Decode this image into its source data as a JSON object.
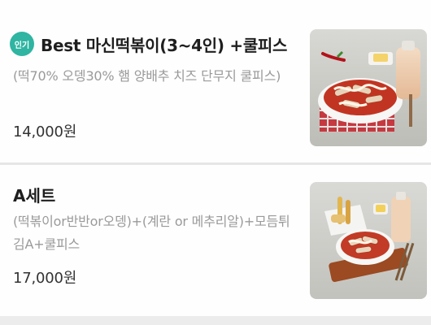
{
  "menu": {
    "items": [
      {
        "badge": "인기",
        "title": "Best 마신떡볶이(3~4인) +쿨피스",
        "description": "(떡70% 오뎅30% 햄 양배추 치즈 단무지 쿨피스)",
        "price": "14,000원",
        "image_icon": "tteokbokki-photo"
      },
      {
        "title": "A세트",
        "description": "(떡볶이or반반or오뎅)+(계란 or 메추리알)+모듬튀김A+쿨피스",
        "price": "17,000원",
        "image_icon": "tteokbokki-set-photo"
      }
    ]
  }
}
